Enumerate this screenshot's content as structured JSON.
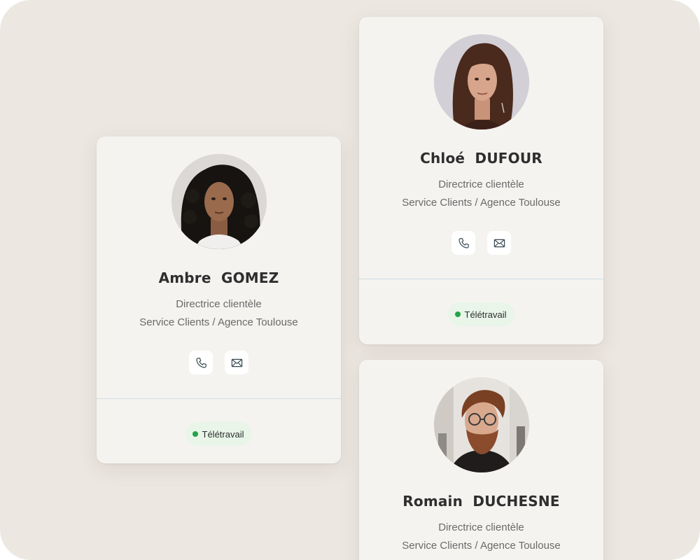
{
  "colors": {
    "background": "#ece7e1",
    "card": "#f5f3f0",
    "name_text": "#2e2e2e",
    "secondary_text": "#6a6a6a",
    "status_bg": "#e8f5e8",
    "status_dot": "#22a447",
    "divider": "#cfdde3"
  },
  "cards": [
    {
      "first_name": "Ambre",
      "last_name": "GOMEZ",
      "role": "Directrice clientèle",
      "department": "Service Clients / Agence Toulouse",
      "actions": [
        {
          "icon": "phone-icon"
        },
        {
          "icon": "mail-icon"
        }
      ],
      "status": "Télétravail"
    },
    {
      "first_name": "Chloé",
      "last_name": "DUFOUR",
      "role": "Directrice clientèle",
      "department": "Service Clients / Agence Toulouse",
      "actions": [
        {
          "icon": "phone-icon"
        },
        {
          "icon": "mail-icon"
        }
      ],
      "status": "Télétravail"
    },
    {
      "first_name": "Romain",
      "last_name": "DUCHESNE",
      "role": "Directrice clientèle",
      "department": "Service Clients / Agence Toulouse"
    }
  ]
}
